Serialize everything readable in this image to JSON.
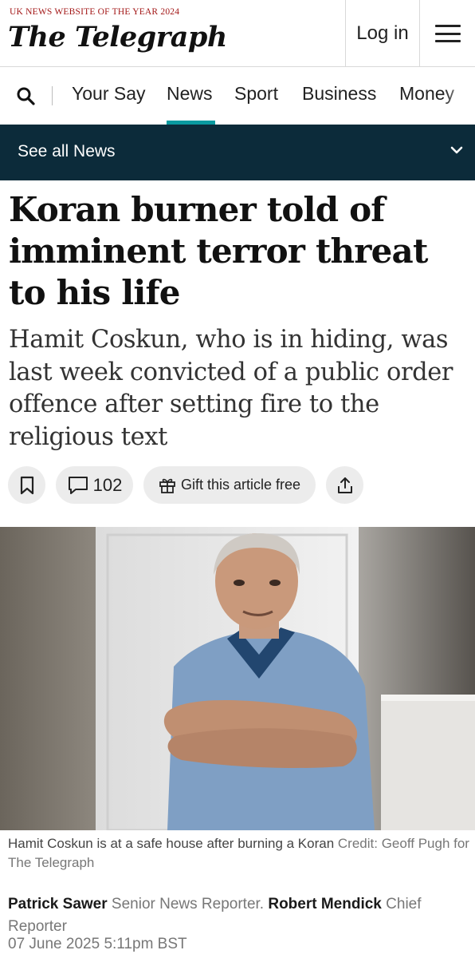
{
  "masthead": {
    "award": "UK NEWS WEBSITE OF THE YEAR 2024",
    "logo": "The Telegraph",
    "login_label": "Log in",
    "menu_icon": "hamburger-menu-icon"
  },
  "nav": {
    "search_icon": "search-icon",
    "items": [
      "Your Say",
      "News",
      "Sport",
      "Business",
      "Money"
    ],
    "active": "News",
    "accent": "#0a9aa0"
  },
  "section_bar": {
    "label": "See all News",
    "background": "#0c2b3a",
    "chevron_icon": "chevron-down-icon"
  },
  "article": {
    "headline": "Koran burner told of imminent terror threat to his life",
    "standfirst": "Hamit Coskun, who is in hiding, was last week convicted of a public order offence after setting fire to the religious text",
    "actions": {
      "bookmark_icon": "bookmark-icon",
      "comments_icon": "comment-icon",
      "comment_count": "102",
      "gift_icon": "gift-icon",
      "gift_label": "Gift this article free",
      "share_icon": "share-icon"
    },
    "image": {
      "description_icon": "photo-man-arms-crossed",
      "caption": "Hamit Coskun is at a safe house after burning a Koran",
      "credit": "Credit: Geoff Pugh for The Telegraph"
    },
    "byline": {
      "author1": "Patrick Sawer",
      "role1": "Senior News Reporter.",
      "author2": "Robert Mendick",
      "role2": "Chief Reporter"
    },
    "date": "07 June 2025 5:11pm BST"
  }
}
